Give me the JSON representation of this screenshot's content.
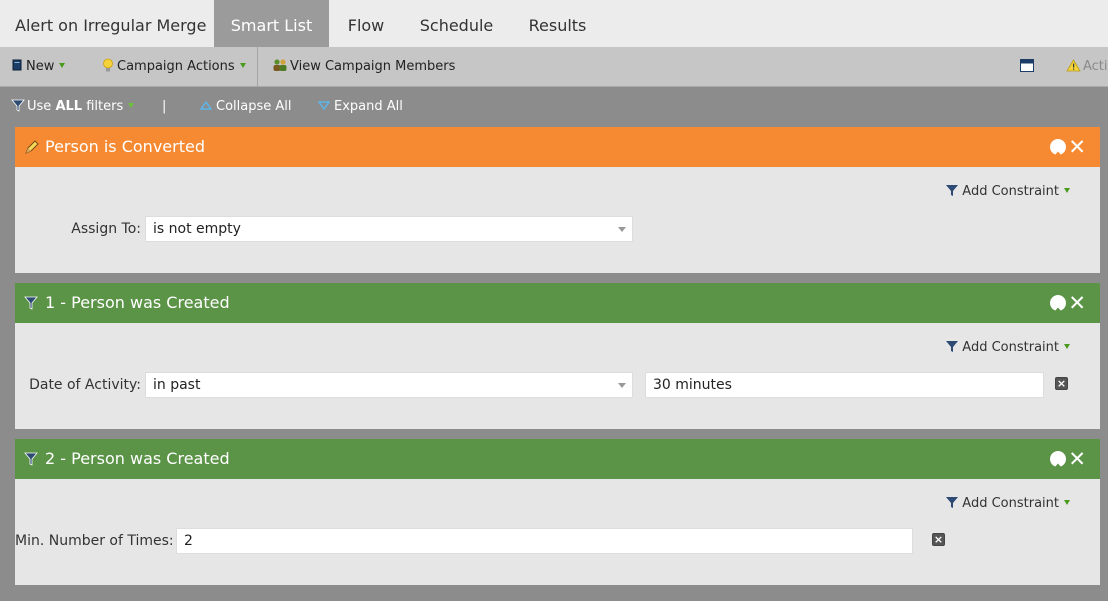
{
  "tabs": [
    "Alert on Irregular Merge",
    "Smart List",
    "Flow",
    "Schedule",
    "Results"
  ],
  "toolbar": {
    "new_label": "New",
    "campaign_actions_label": "Campaign Actions",
    "view_members_label": "View Campaign Members",
    "activate_label": "Acti"
  },
  "filterbar": {
    "use_prefix": "Use",
    "use_all": "ALL",
    "use_suffix": "filters",
    "divider": "|",
    "collapse_label": "Collapse All",
    "expand_label": "Expand All"
  },
  "filters": [
    {
      "title": "Person is Converted",
      "color": "#f58a33",
      "add_constraint": "Add Constraint",
      "label": "Assign To:",
      "operator": "is not empty"
    },
    {
      "title": "1 - Person was Created",
      "color": "#5b9447",
      "add_constraint": "Add Constraint",
      "label": "Date of Activity:",
      "operator": "in past",
      "value": "30 minutes"
    },
    {
      "title": "2 - Person was Created",
      "color": "#5b9447",
      "add_constraint": "Add Constraint",
      "label": "Min. Number of Times:",
      "value": "2"
    }
  ]
}
